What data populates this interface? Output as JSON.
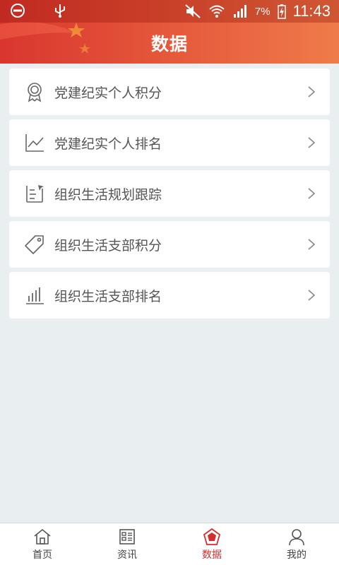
{
  "status_bar": {
    "battery_percent": "7%",
    "time": "11:43"
  },
  "header": {
    "title": "数据"
  },
  "menu": {
    "items": [
      {
        "label": "党建纪实个人积分",
        "icon": "award-medal-icon"
      },
      {
        "label": "党建纪实个人排名",
        "icon": "line-chart-icon"
      },
      {
        "label": "组织生活规划跟踪",
        "icon": "plan-tracking-icon"
      },
      {
        "label": "组织生活支部积分",
        "icon": "tag-icon"
      },
      {
        "label": "组织生活支部排名",
        "icon": "bar-chart-icon"
      }
    ]
  },
  "bottom_nav": {
    "items": [
      {
        "label": "首页",
        "icon": "home-icon",
        "active": false
      },
      {
        "label": "资讯",
        "icon": "news-icon",
        "active": false
      },
      {
        "label": "数据",
        "icon": "data-icon",
        "active": true
      },
      {
        "label": "我的",
        "icon": "user-icon",
        "active": false
      }
    ]
  },
  "colors": {
    "header_start": "#d9362e",
    "header_end": "#ef7b4a",
    "active_tab": "#d42d2d",
    "background": "#e9eef0"
  }
}
